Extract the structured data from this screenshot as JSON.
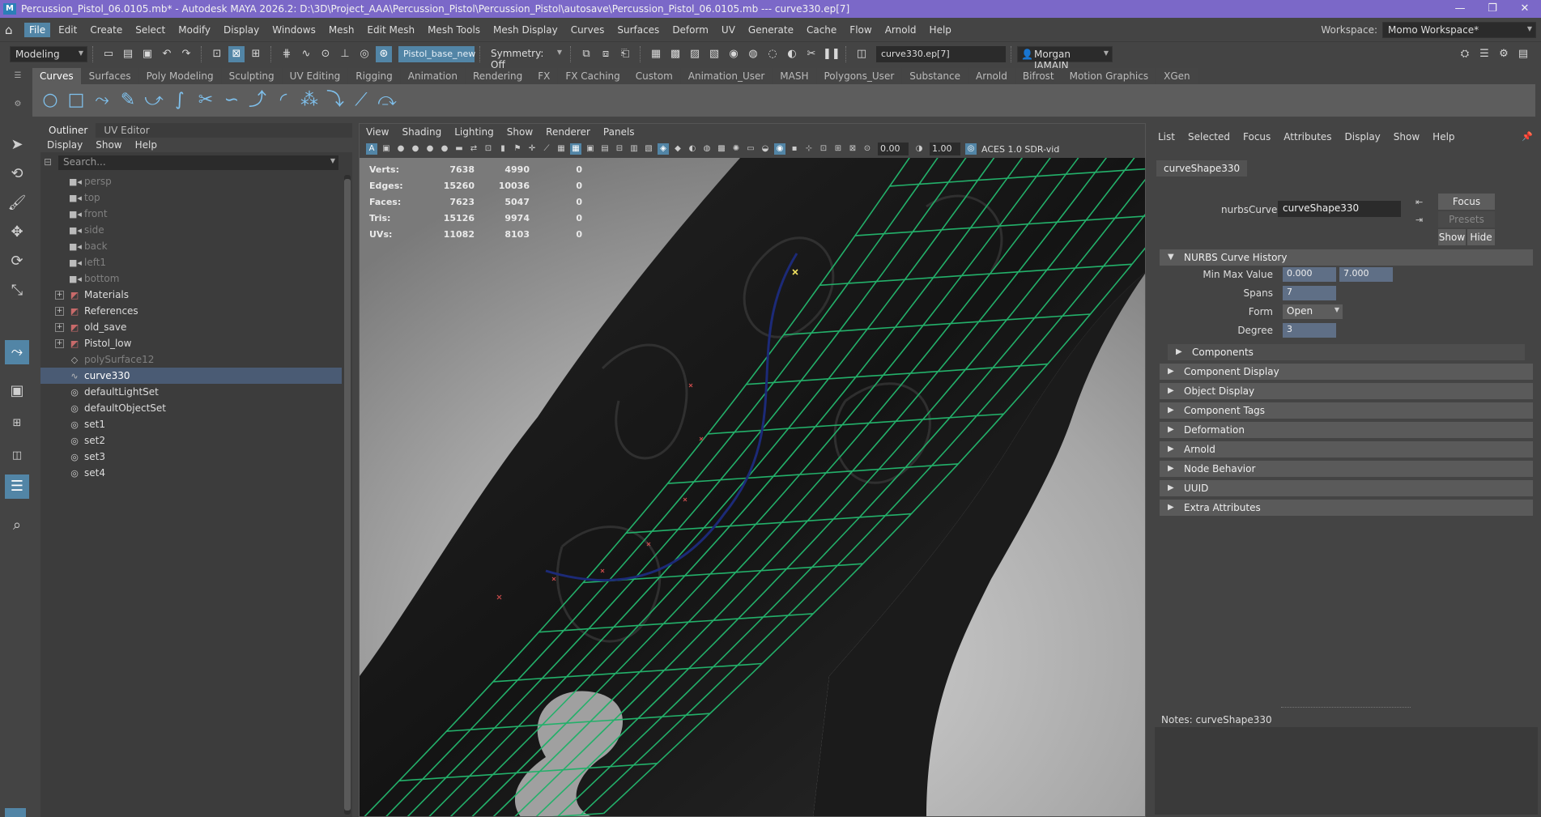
{
  "titlebar": {
    "title": "Percussion_Pistol_06.0105.mb* - Autodesk MAYA 2026.2: D:\\3D\\Project_AAA\\Percussion_Pistol\\Percussion_Pistol\\autosave\\Percussion_Pistol_06.0105.mb   ---   curve330.ep[7]",
    "minimize": "—",
    "restore": "❐",
    "close": "✕"
  },
  "menubar": {
    "items": [
      "File",
      "Edit",
      "Create",
      "Select",
      "Modify",
      "Display",
      "Windows",
      "Mesh",
      "Edit Mesh",
      "Mesh Tools",
      "Mesh Display",
      "Curves",
      "Surfaces",
      "Deform",
      "UV",
      "Generate",
      "Cache",
      "Flow",
      "Arnold",
      "Help"
    ],
    "active": "File",
    "workspace_label": "Workspace:",
    "workspace_value": "Momo Workspace*"
  },
  "statusline": {
    "menuset": "Modeling",
    "object_name": "Pistol_base_new",
    "symmetry": "Symmetry: Off",
    "selection_field": "curve330.ep[7]",
    "user": "Morgan JAMAIN"
  },
  "shelf": {
    "tabs": [
      "Curves",
      "Surfaces",
      "Poly Modeling",
      "Sculpting",
      "UV Editing",
      "Rigging",
      "Animation",
      "Rendering",
      "FX",
      "FX Caching",
      "Custom",
      "Animation_User",
      "MASH",
      "Polygons_User",
      "Substance",
      "Arnold",
      "Bifrost",
      "Motion Graphics",
      "XGen"
    ],
    "active_tab": "Curves"
  },
  "outliner": {
    "tabs": [
      "Outliner",
      "UV Editor"
    ],
    "menus": [
      "Display",
      "Show",
      "Help"
    ],
    "search_placeholder": "Search...",
    "rows": [
      {
        "label": "persp",
        "icon": "camera-icon",
        "dim": true,
        "expand": false
      },
      {
        "label": "top",
        "icon": "camera-icon",
        "dim": true,
        "expand": false
      },
      {
        "label": "front",
        "icon": "camera-icon",
        "dim": true,
        "expand": false
      },
      {
        "label": "side",
        "icon": "camera-icon",
        "dim": true,
        "expand": false
      },
      {
        "label": "back",
        "icon": "camera-icon",
        "dim": true,
        "expand": false
      },
      {
        "label": "left1",
        "icon": "camera-icon",
        "dim": true,
        "expand": false
      },
      {
        "label": "bottom",
        "icon": "camera-icon",
        "dim": true,
        "expand": false
      },
      {
        "label": "Materials",
        "icon": "group-icon",
        "dim": false,
        "expand": true
      },
      {
        "label": "References",
        "icon": "group-icon",
        "dim": false,
        "expand": true
      },
      {
        "label": "old_save",
        "icon": "group-icon",
        "dim": false,
        "expand": true
      },
      {
        "label": "Pistol_low",
        "icon": "group-icon",
        "dim": false,
        "expand": true
      },
      {
        "label": "polySurface12",
        "icon": "mesh-icon",
        "dim": true,
        "expand": false
      },
      {
        "label": "curve330",
        "icon": "curve-icon",
        "dim": false,
        "expand": false,
        "selected": true
      },
      {
        "label": "defaultLightSet",
        "icon": "set-icon",
        "dim": false,
        "expand": false
      },
      {
        "label": "defaultObjectSet",
        "icon": "set-icon",
        "dim": false,
        "expand": false
      },
      {
        "label": "set1",
        "icon": "set-icon",
        "dim": false,
        "expand": false
      },
      {
        "label": "set2",
        "icon": "set-icon",
        "dim": false,
        "expand": false
      },
      {
        "label": "set3",
        "icon": "set-icon",
        "dim": false,
        "expand": false
      },
      {
        "label": "set4",
        "icon": "set-icon",
        "dim": false,
        "expand": false
      }
    ]
  },
  "viewport": {
    "menus": [
      "View",
      "Shading",
      "Lighting",
      "Show",
      "Renderer",
      "Panels"
    ],
    "near_value": "0.00",
    "far_value": "1.00",
    "colorspace": "ACES 1.0 SDR-vid",
    "hud": [
      {
        "label": "Verts:",
        "v1": "7638",
        "v2": "4990",
        "v3": "0"
      },
      {
        "label": "Edges:",
        "v1": "15260",
        "v2": "10036",
        "v3": "0"
      },
      {
        "label": "Faces:",
        "v1": "7623",
        "v2": "5047",
        "v3": "0"
      },
      {
        "label": "Tris:",
        "v1": "15126",
        "v2": "9974",
        "v3": "0"
      },
      {
        "label": "UVs:",
        "v1": "11082",
        "v2": "8103",
        "v3": "0"
      }
    ],
    "wire_color": "#23b06a",
    "curve_color": "#1c2a78"
  },
  "attribute_editor": {
    "menus": [
      "List",
      "Selected",
      "Focus",
      "Attributes",
      "Display",
      "Show",
      "Help"
    ],
    "node_tab": "curveShape330",
    "node_label": "nurbsCurve:",
    "node_value": "curveShape330",
    "focus_btn": "Focus",
    "presets_btn": "Presets",
    "show_btn": "Show",
    "hide_btn": "Hide",
    "history_section": "NURBS Curve History",
    "min_max_label": "Min Max Value",
    "min_value": "0.000",
    "max_value": "7.000",
    "spans_label": "Spans",
    "spans_value": "7",
    "form_label": "Form",
    "form_value": "Open",
    "degree_label": "Degree",
    "degree_value": "3",
    "components_section": "Components",
    "sections": [
      "Component Display",
      "Object Display",
      "Component Tags",
      "Deformation",
      "Arnold",
      "Node Behavior",
      "UUID",
      "Extra Attributes"
    ],
    "notes_label": "Notes:  curveShape330"
  }
}
